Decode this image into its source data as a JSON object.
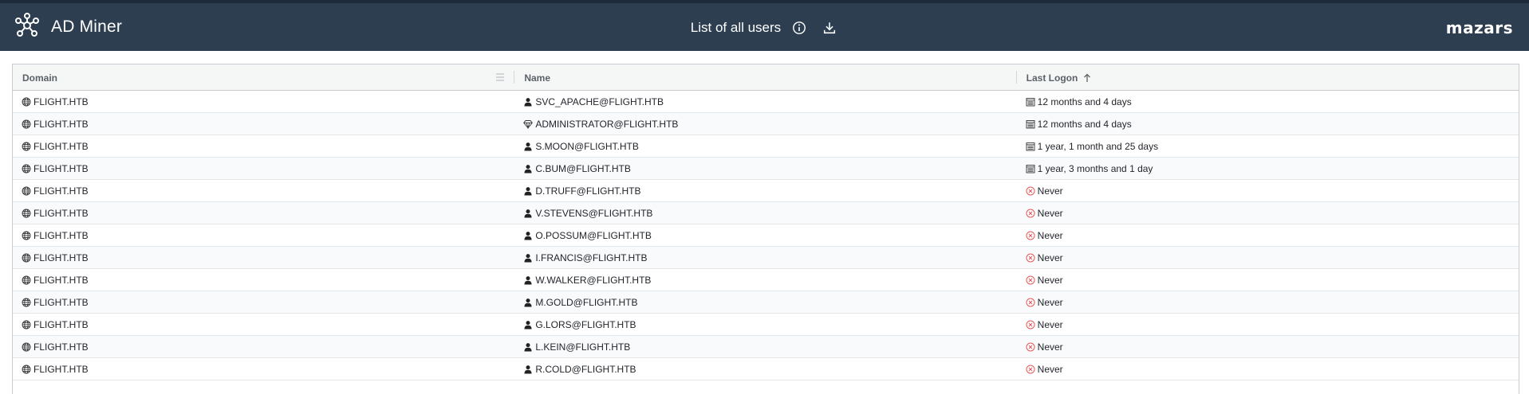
{
  "app": {
    "title": "AD Miner",
    "logo_text": "mazars"
  },
  "header": {
    "page_title": "List of all users",
    "info_icon": "info-icon",
    "download_icon": "download-icon"
  },
  "columns": {
    "domain": "Domain",
    "name": "Name",
    "last_logon": "Last Logon",
    "sort_direction": "ascending"
  },
  "rows": [
    {
      "domain": "FLIGHT.HTB",
      "name": "SVC_APACHE@FLIGHT.HTB",
      "name_icon": "user-icon",
      "last_logon": "12 months and 4 days",
      "logon_icon": "calendar-icon"
    },
    {
      "domain": "FLIGHT.HTB",
      "name": "ADMINISTRATOR@FLIGHT.HTB",
      "name_icon": "diamond-icon",
      "last_logon": "12 months and 4 days",
      "logon_icon": "calendar-icon"
    },
    {
      "domain": "FLIGHT.HTB",
      "name": "S.MOON@FLIGHT.HTB",
      "name_icon": "user-icon",
      "last_logon": "1 year, 1 month and 25 days",
      "logon_icon": "calendar-icon"
    },
    {
      "domain": "FLIGHT.HTB",
      "name": "C.BUM@FLIGHT.HTB",
      "name_icon": "user-icon",
      "last_logon": "1 year, 3 months and 1 day",
      "logon_icon": "calendar-icon"
    },
    {
      "domain": "FLIGHT.HTB",
      "name": "D.TRUFF@FLIGHT.HTB",
      "name_icon": "user-icon",
      "last_logon": "Never",
      "logon_icon": "never-icon"
    },
    {
      "domain": "FLIGHT.HTB",
      "name": "V.STEVENS@FLIGHT.HTB",
      "name_icon": "user-icon",
      "last_logon": "Never",
      "logon_icon": "never-icon"
    },
    {
      "domain": "FLIGHT.HTB",
      "name": "O.POSSUM@FLIGHT.HTB",
      "name_icon": "user-icon",
      "last_logon": "Never",
      "logon_icon": "never-icon"
    },
    {
      "domain": "FLIGHT.HTB",
      "name": "I.FRANCIS@FLIGHT.HTB",
      "name_icon": "user-icon",
      "last_logon": "Never",
      "logon_icon": "never-icon"
    },
    {
      "domain": "FLIGHT.HTB",
      "name": "W.WALKER@FLIGHT.HTB",
      "name_icon": "user-icon",
      "last_logon": "Never",
      "logon_icon": "never-icon"
    },
    {
      "domain": "FLIGHT.HTB",
      "name": "M.GOLD@FLIGHT.HTB",
      "name_icon": "user-icon",
      "last_logon": "Never",
      "logon_icon": "never-icon"
    },
    {
      "domain": "FLIGHT.HTB",
      "name": "G.LORS@FLIGHT.HTB",
      "name_icon": "user-icon",
      "last_logon": "Never",
      "logon_icon": "never-icon"
    },
    {
      "domain": "FLIGHT.HTB",
      "name": "L.KEIN@FLIGHT.HTB",
      "name_icon": "user-icon",
      "last_logon": "Never",
      "logon_icon": "never-icon"
    },
    {
      "domain": "FLIGHT.HTB",
      "name": "R.COLD@FLIGHT.HTB",
      "name_icon": "user-icon",
      "last_logon": "Never",
      "logon_icon": "never-icon"
    }
  ],
  "colors": {
    "header_bg": "#2c3e50",
    "never_icon": "#e05a5a",
    "row_alt": "#f9fafc"
  }
}
